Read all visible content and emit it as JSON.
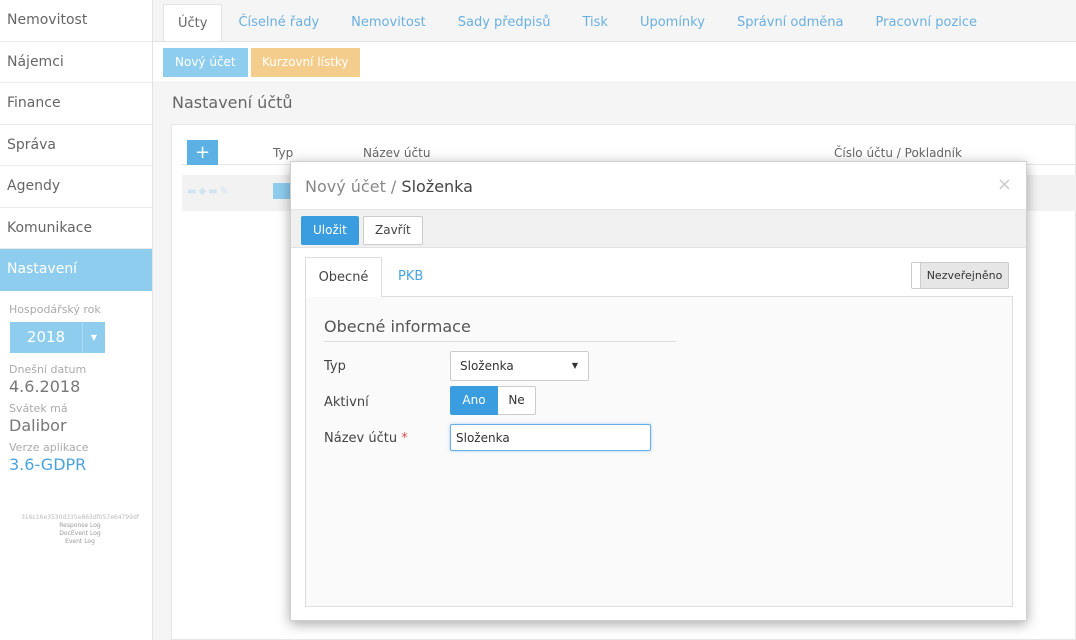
{
  "sidebar": {
    "items": [
      {
        "label": "Nemovitost"
      },
      {
        "label": "Nájemci"
      },
      {
        "label": "Finance"
      },
      {
        "label": "Správa"
      },
      {
        "label": "Agendy"
      },
      {
        "label": "Komunikace"
      },
      {
        "label": "Nastavení"
      }
    ],
    "active_index": 6,
    "fiscal_year_label": "Hospodářský rok",
    "fiscal_year": "2018",
    "today_label": "Dnešní datum",
    "today": "4.6.2018",
    "nameday_label": "Svátek má",
    "nameday": "Dalibor",
    "version_label": "Verze aplikace",
    "version": "3.6-GDPR",
    "hash": "316c16e3530d335e863df057e64799df",
    "links": [
      "Response Log",
      "DocEvent Log",
      "Event Log"
    ]
  },
  "tabs": [
    {
      "label": "Účty"
    },
    {
      "label": "Číselné řady"
    },
    {
      "label": "Nemovitost"
    },
    {
      "label": "Sady předpisů"
    },
    {
      "label": "Tisk"
    },
    {
      "label": "Upomínky"
    },
    {
      "label": "Správní odměna"
    },
    {
      "label": "Pracovní pozice"
    }
  ],
  "toolbar": {
    "new_account": "Nový účet",
    "exchange_rates": "Kurzovní lístky"
  },
  "page_title": "Nastavení účtů",
  "grid": {
    "add_icon": "+",
    "columns": [
      "Typ",
      "Název účtu",
      "Číslo účtu / Pokladník"
    ]
  },
  "modal": {
    "title_prefix": "Nový účet / ",
    "title_name": "Složenka",
    "close_icon": "×",
    "save_label": "Uložit",
    "close_label": "Zavřít",
    "tabs": [
      "Obecné",
      "PKB"
    ],
    "publish_toggle": "Nezveřejněno",
    "section_title": "Obecné informace",
    "fields": {
      "type_label": "Typ",
      "type_value": "Složenka",
      "active_label": "Aktivní",
      "active_yes": "Ano",
      "active_no": "Ne",
      "name_label": "Název účtu",
      "name_required": "*",
      "name_value": "Složenka"
    }
  },
  "colors": {
    "accent": "#3a9de0",
    "sidebar_active": "#8fcdef",
    "warning": "#f4cd8c"
  }
}
